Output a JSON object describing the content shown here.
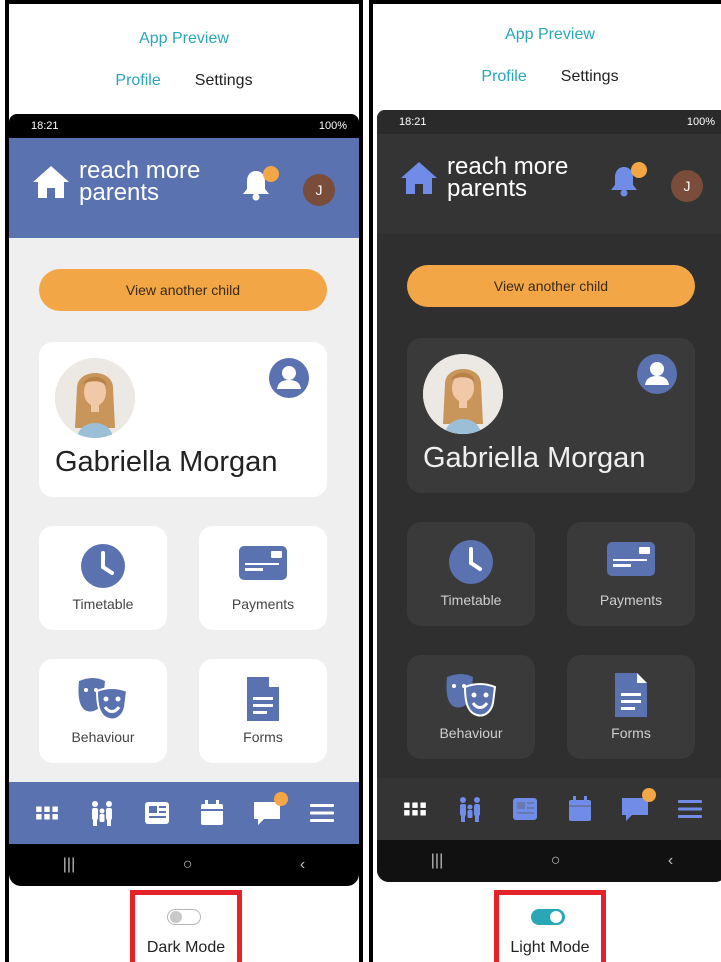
{
  "colors": {
    "accent": "#2aa7b6",
    "brand_blue": "#5a72b0",
    "orange": "#f3a646",
    "highlight_red": "#e3222a",
    "dark_bg": "#2f2f2f",
    "light_bg": "#efefef"
  },
  "panels": [
    {
      "title": "App Preview",
      "tabs": [
        "Profile",
        "Settings"
      ],
      "status": {
        "time": "18:21",
        "battery": "100%"
      },
      "logo": {
        "line1": "reach more",
        "line2": "parents"
      },
      "avatar_initial": "J",
      "view_child_label": "View another child",
      "child_name": "Gabriella Morgan",
      "tiles": [
        "Timetable",
        "Payments",
        "Behaviour",
        "Forms"
      ],
      "nav_icons": [
        "apps-icon",
        "family-icon",
        "newspaper-icon",
        "calendar-icon",
        "chat-icon",
        "menu-icon"
      ],
      "mode_toggle": {
        "label": "Dark Mode",
        "state": "off"
      }
    },
    {
      "title": "App Preview",
      "tabs": [
        "Profile",
        "Settings"
      ],
      "status": {
        "time": "18:21",
        "battery": "100%"
      },
      "logo": {
        "line1": "reach more",
        "line2": "parents"
      },
      "avatar_initial": "J",
      "view_child_label": "View another child",
      "child_name": "Gabriella Morgan",
      "tiles": [
        "Timetable",
        "Payments",
        "Behaviour",
        "Forms"
      ],
      "nav_icons": [
        "apps-icon",
        "family-icon",
        "newspaper-icon",
        "calendar-icon",
        "chat-icon",
        "menu-icon"
      ],
      "mode_toggle": {
        "label": "Light Mode",
        "state": "on"
      }
    }
  ]
}
